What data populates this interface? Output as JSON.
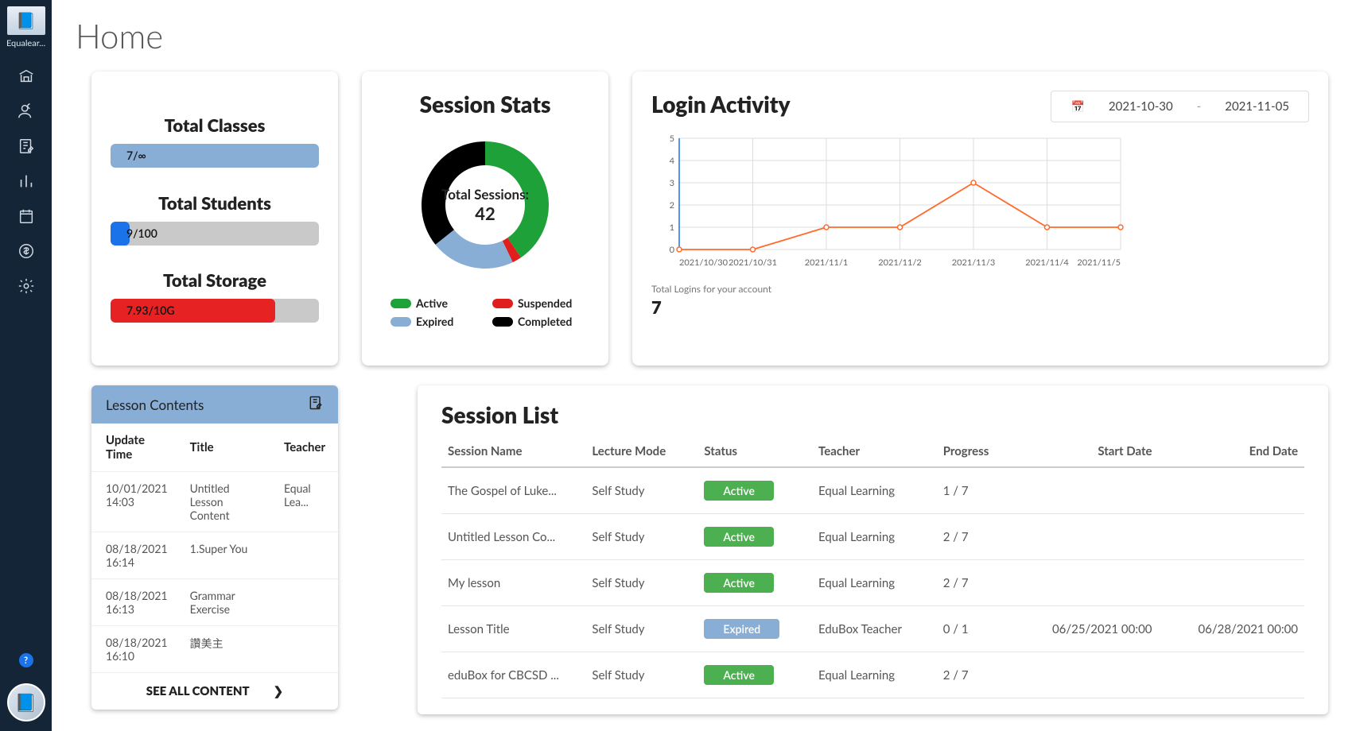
{
  "sidebar": {
    "brand_short": "Equalear..."
  },
  "page": {
    "title": "Home"
  },
  "totals": {
    "classes": {
      "label": "Total Classes",
      "value": "7/∞",
      "pct": 100
    },
    "students": {
      "label": "Total Students",
      "value": "9/100",
      "pct": 9
    },
    "storage": {
      "label": "Total Storage",
      "value": "7.93/10G",
      "pct": 79
    }
  },
  "session_stats": {
    "title": "Session Stats",
    "center_label": "Total Sessions:",
    "center_value": "42",
    "legend": {
      "active": "Active",
      "suspended": "Suspended",
      "expired": "Expired",
      "completed": "Completed"
    }
  },
  "login_activity": {
    "title": "Login Activity",
    "range_start": "2021-10-30",
    "range_end": "2021-11-05",
    "footer_label": "Total Logins for your account",
    "footer_value": "7"
  },
  "lesson_contents": {
    "title": "Lesson Contents",
    "headers": {
      "update_time": "Update Time",
      "title": "Title",
      "teacher": "Teacher"
    },
    "rows": [
      {
        "time": "10/01/2021 14:03",
        "title": "Untitled Lesson Content",
        "teacher": "Equal Lea..."
      },
      {
        "time": "08/18/2021 16:14",
        "title": "1.Super You",
        "teacher": ""
      },
      {
        "time": "08/18/2021 16:13",
        "title": "Grammar Exercise",
        "teacher": ""
      },
      {
        "time": "08/18/2021 16:10",
        "title": "讚美主",
        "teacher": ""
      }
    ],
    "see_all": "SEE ALL CONTENT"
  },
  "session_list": {
    "title": "Session List",
    "headers": {
      "name": "Session Name",
      "mode": "Lecture Mode",
      "status": "Status",
      "teacher": "Teacher",
      "progress": "Progress",
      "start": "Start Date",
      "end": "End Date"
    },
    "rows": [
      {
        "name": "The Gospel of Luke...",
        "mode": "Self Study",
        "status": "Active",
        "badge": "active",
        "teacher": "Equal Learning",
        "progress": "1 / 7",
        "start": "",
        "end": ""
      },
      {
        "name": "Untitled Lesson Co...",
        "mode": "Self Study",
        "status": "Active",
        "badge": "active",
        "teacher": "Equal Learning",
        "progress": "2 / 7",
        "start": "",
        "end": ""
      },
      {
        "name": "My lesson",
        "mode": "Self Study",
        "status": "Active",
        "badge": "active",
        "teacher": "Equal Learning",
        "progress": "2 / 7",
        "start": "",
        "end": ""
      },
      {
        "name": "Lesson Title",
        "mode": "Self Study",
        "status": "Expired",
        "badge": "expired",
        "teacher": "EduBox Teacher",
        "progress": "0 / 1",
        "start": "06/25/2021 00:00",
        "end": "06/28/2021 00:00"
      },
      {
        "name": "eduBox for CBCSD ...",
        "mode": "Self Study",
        "status": "Active",
        "badge": "active",
        "teacher": "Equal Learning",
        "progress": "2 / 7",
        "start": "",
        "end": ""
      }
    ]
  },
  "chart_data": [
    {
      "type": "pie",
      "title": "Session Stats",
      "series": [
        {
          "name": "Active",
          "value": 17,
          "color": "#1fa13a"
        },
        {
          "name": "Suspended",
          "value": 1,
          "color": "#e01e1e"
        },
        {
          "name": "Expired",
          "value": 9,
          "color": "#89aed6"
        },
        {
          "name": "Completed",
          "value": 15,
          "color": "#000000"
        }
      ],
      "total": 42,
      "donut": true
    },
    {
      "type": "line",
      "title": "Login Activity",
      "xlabel": "",
      "ylabel": "",
      "ylim": [
        0,
        5
      ],
      "categories": [
        "2021/10/30",
        "2021/10/31",
        "2021/11/1",
        "2021/11/2",
        "2021/11/3",
        "2021/11/4",
        "2021/11/5"
      ],
      "values": [
        0,
        0,
        1,
        1,
        3,
        1,
        1
      ],
      "color": "#ff6a2b"
    }
  ]
}
